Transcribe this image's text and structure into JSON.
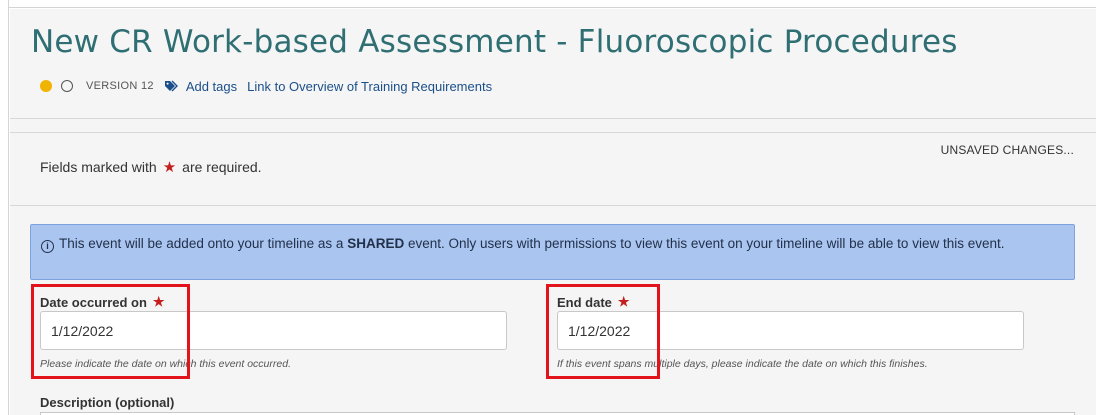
{
  "header": {
    "title": "New CR Work-based Assessment - Fluoroscopic Procedures",
    "version": "VERSION 12",
    "add_tags": "Add tags",
    "overview_link": "Link to Overview of Training Requirements"
  },
  "form": {
    "required_note_prefix": "Fields marked with",
    "required_note_suffix": "are required.",
    "unsaved": "UNSAVED CHANGES...",
    "info": {
      "prefix": "This event will be added onto your timeline as a",
      "emphasis": "SHARED",
      "suffix": "event. Only users with permissions to view this event on your timeline will be able to view this event."
    },
    "date_occurred": {
      "label": "Date occurred on",
      "value": "1/12/2022",
      "hint": "Please indicate the date on which this event occurred."
    },
    "end_date": {
      "label": "End date",
      "value": "1/12/2022",
      "hint": "If this event spans multiple days, please indicate the date on which this finishes."
    },
    "description": {
      "label": "Description (optional)"
    }
  },
  "colors": {
    "title": "#2f6f73",
    "link": "#1b4f8a",
    "required_star": "#c41e1e",
    "info_bg": "#aac6f0",
    "highlight": "#e2131b",
    "status_dot": "#f0b400"
  },
  "icons": [
    "tag-icon",
    "info-icon",
    "required-star-icon"
  ]
}
